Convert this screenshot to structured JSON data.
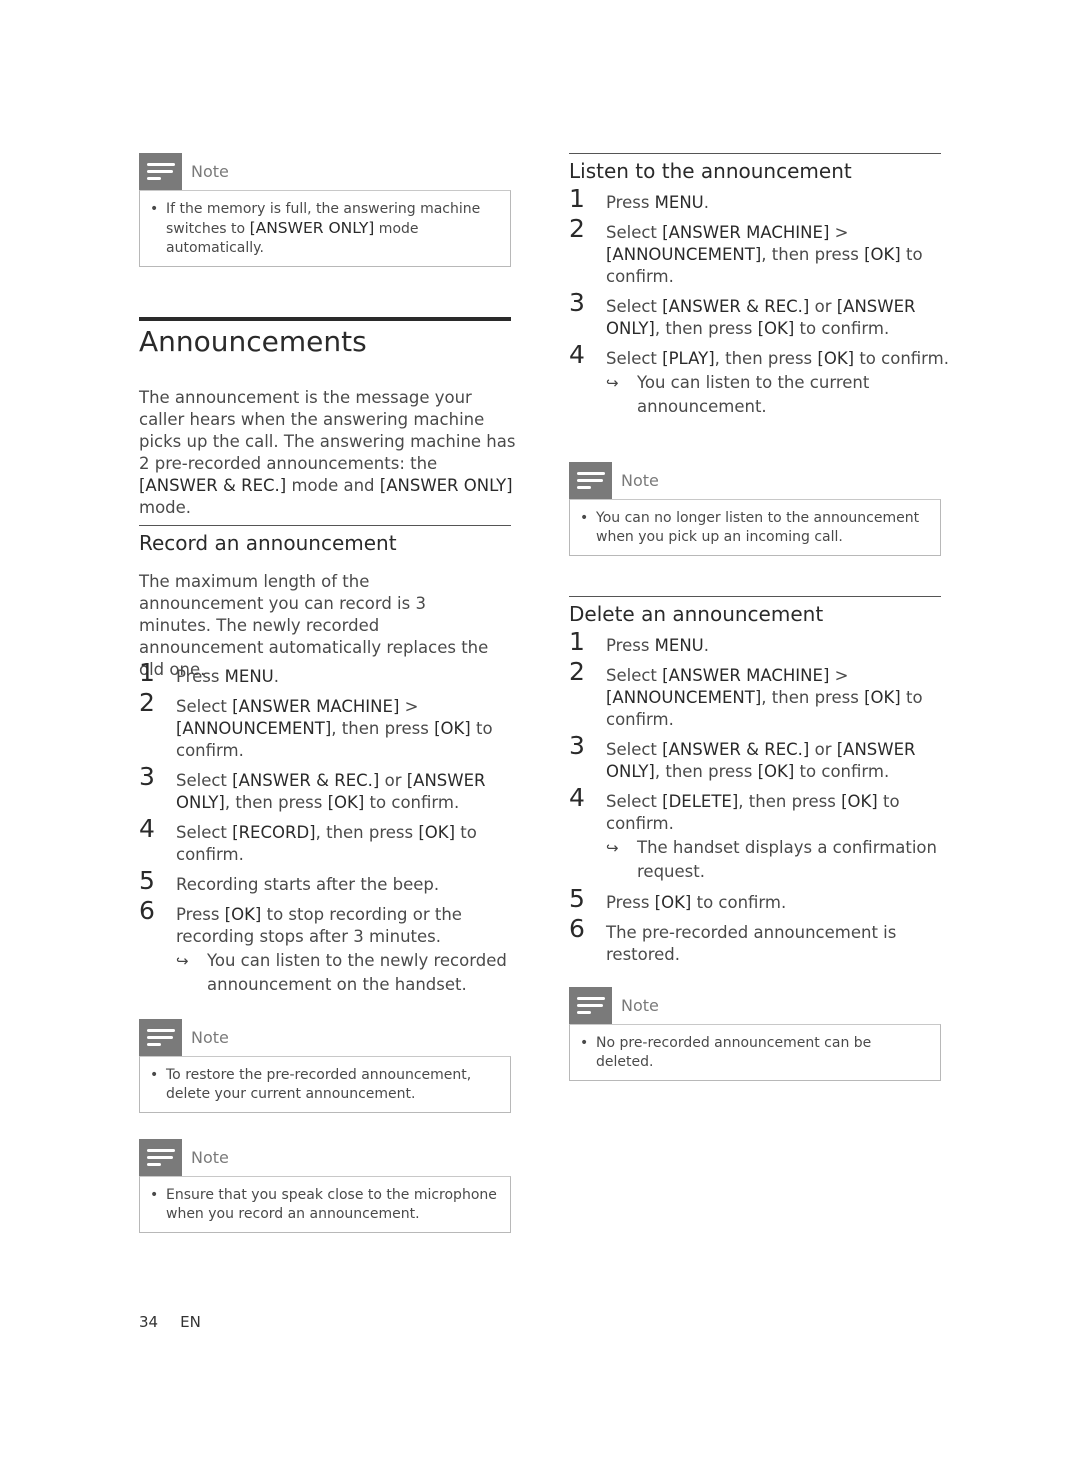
{
  "left": {
    "note_memory": {
      "title": "Note",
      "text_parts": [
        "If the memory is full, the answering machine switches to ",
        "[ANSWER ONLY]",
        " mode automatically."
      ]
    },
    "section_title": "Announcements",
    "intro_parts": [
      "The announcement is the message your caller hears when the answering machine picks up the call. The answering machine has 2 pre-recorded announcements: the ",
      "[ANSWER & REC.]",
      " mode and ",
      "[ANSWER ONLY]",
      " mode."
    ],
    "record": {
      "title": "Record an announcement",
      "intro": "The maximum length of the announcement you can record is 3 minutes. The newly recorded announcement automatically replaces the old one.",
      "steps": [
        {
          "num": "1",
          "parts": [
            "Press ",
            "MENU",
            "."
          ]
        },
        {
          "num": "2",
          "parts": [
            "Select ",
            "[ANSWER MACHINE]",
            " > ",
            "[ANNOUNCEMENT]",
            ", then press ",
            "[OK]",
            " to confirm."
          ]
        },
        {
          "num": "3",
          "parts": [
            "Select ",
            "[ANSWER & REC.]",
            " or ",
            "[ANSWER ONLY]",
            ", then press ",
            "[OK]",
            " to confirm."
          ]
        },
        {
          "num": "4",
          "parts": [
            "Select ",
            "[RECORD]",
            ", then press ",
            "[OK]",
            " to confirm."
          ]
        },
        {
          "num": "5",
          "parts": [
            "Recording starts after the beep."
          ]
        },
        {
          "num": "6",
          "parts": [
            "Press ",
            "[OK]",
            " to stop recording or the recording stops after 3 minutes."
          ],
          "result": "You can listen to the newly recorded announcement on the handset."
        }
      ]
    },
    "note_restore": {
      "title": "Note",
      "text": "To restore the pre-recorded announcement, delete your current announcement."
    },
    "note_microphone": {
      "title": "Note",
      "text": "Ensure that you speak close to the microphone when you record an announcement."
    }
  },
  "right": {
    "listen": {
      "title": "Listen to the announcement",
      "steps": [
        {
          "num": "1",
          "parts": [
            "Press ",
            "MENU",
            "."
          ]
        },
        {
          "num": "2",
          "parts": [
            "Select ",
            "[ANSWER MACHINE]",
            " > ",
            "[ANNOUNCEMENT]",
            ", then press ",
            "[OK]",
            " to confirm."
          ]
        },
        {
          "num": "3",
          "parts": [
            "Select ",
            "[ANSWER & REC.]",
            " or ",
            "[ANSWER ONLY]",
            ", then press ",
            "[OK]",
            " to confirm."
          ]
        },
        {
          "num": "4",
          "parts": [
            "Select ",
            "[PLAY]",
            ", then press ",
            "[OK]",
            " to confirm."
          ],
          "result": "You can listen to the current announcement."
        }
      ]
    },
    "note_listen": {
      "title": "Note",
      "text": "You can no longer listen to the announcement when you pick up an incoming call."
    },
    "delete": {
      "title": "Delete an announcement",
      "steps": [
        {
          "num": "1",
          "parts": [
            "Press ",
            "MENU",
            "."
          ]
        },
        {
          "num": "2",
          "parts": [
            "Select ",
            "[ANSWER MACHINE]",
            " > ",
            "[ANNOUNCEMENT]",
            ", then press ",
            "[OK]",
            " to confirm."
          ]
        },
        {
          "num": "3",
          "parts": [
            "Select ",
            "[ANSWER & REC.]",
            " or ",
            "[ANSWER ONLY]",
            ", then press ",
            "[OK]",
            " to confirm."
          ]
        },
        {
          "num": "4",
          "parts": [
            "Select ",
            "[DELETE]",
            ", then press ",
            "[OK]",
            " to confirm."
          ],
          "result": "The handset displays a confirmation request."
        },
        {
          "num": "5",
          "parts": [
            "Press ",
            "[OK]",
            " to confirm."
          ]
        },
        {
          "num": "6",
          "parts": [
            "The pre-recorded announcement is restored."
          ]
        }
      ]
    },
    "note_delete": {
      "title": "Note",
      "text": "No pre-recorded announcement can be deleted."
    }
  },
  "footer": {
    "page_number": "34",
    "language": "EN"
  },
  "icons": {
    "note": "note-icon",
    "result_arrow": "↪"
  }
}
